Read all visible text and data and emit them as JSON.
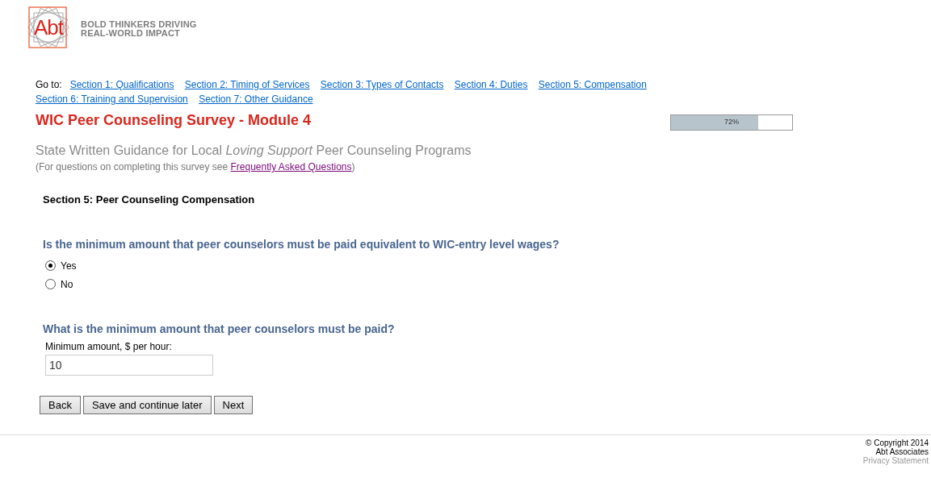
{
  "logo": {
    "mark": "Abt",
    "tagline": [
      "BOLD THINKERS DRIVING",
      "REAL-WORLD IMPACT"
    ]
  },
  "nav": {
    "label": "Go to:",
    "links": [
      "Section 1: Qualifications",
      "Section 2: Timing of Services",
      "Section 3: Types of Contacts",
      "Section 4: Duties",
      "Section 5: Compensation",
      "Section 6: Training and Supervision",
      "Section 7: Other Guidance"
    ]
  },
  "title": "WIC Peer Counseling Survey - Module 4",
  "progress": {
    "level": 0.72,
    "reading": "72%"
  },
  "subtitle": "State Written Guidance for Local *Loving Support* Peer Counseling Programs",
  "note": {
    "before": "(For questions on completing this survey see ",
    "link": "Frequently Asked Questions",
    "after": ")"
  },
  "section_heading": "Section 5: Peer Counseling Compensation",
  "questions": [
    {
      "kind": "radio",
      "text": "Is the minimum amount that peer counselors must be paid equivalent to WIC-entry level wages?",
      "options": [
        {
          "label": "Yes",
          "selected": true
        },
        {
          "label": "No",
          "selected": false
        }
      ]
    },
    {
      "kind": "text",
      "text": "What is the minimum amount that peer counselors must be paid?",
      "field_label": "Minimum amount, $ per hour:",
      "value": "10"
    }
  ],
  "buttons": [
    "Back",
    "Save and continue later",
    "Next"
  ],
  "footer": {
    "copyright": "© Copyright 2014",
    "company": "Abt Associates",
    "privacy": "Privacy Statement"
  }
}
